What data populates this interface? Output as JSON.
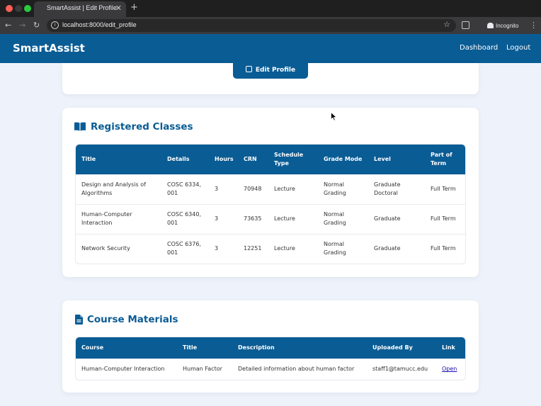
{
  "browser": {
    "tab_title": "SmartAssist | Edit Profile",
    "url": "localhost:8000/edit_profile",
    "incognito_label": "Incognito"
  },
  "navbar": {
    "brand": "SmartAssist",
    "links": [
      "Dashboard",
      "Logout"
    ]
  },
  "profile_card": {
    "edit_button_label": "Edit Profile"
  },
  "registered_classes": {
    "title": "Registered Classes",
    "columns": [
      "Title",
      "Details",
      "Hours",
      "CRN",
      "Schedule Type",
      "Grade Mode",
      "Level",
      "Part of Term"
    ],
    "rows": [
      [
        "Design and Analysis of Algorithms",
        "COSC 6334, 001",
        "3",
        "70948",
        "Lecture",
        "Normal Grading",
        "Graduate Doctoral",
        "Full Term"
      ],
      [
        "Human-Computer Interaction",
        "COSC 6340, 001",
        "3",
        "73635",
        "Lecture",
        "Normal Grading",
        "Graduate",
        "Full Term"
      ],
      [
        "Network Security",
        "COSC 6376, 001",
        "3",
        "12251",
        "Lecture",
        "Normal Grading",
        "Graduate",
        "Full Term"
      ]
    ]
  },
  "course_materials": {
    "title": "Course Materials",
    "columns": [
      "Course",
      "Title",
      "Description",
      "Uploaded By",
      "Link"
    ],
    "rows": [
      [
        "Human-Computer Interaction",
        "Human Factor",
        "Detailed information about human factor",
        "staff1@tamucc.edu",
        "Open"
      ]
    ]
  },
  "colors": {
    "primary": "#0a5c94",
    "page_background": "#eef3fb"
  }
}
